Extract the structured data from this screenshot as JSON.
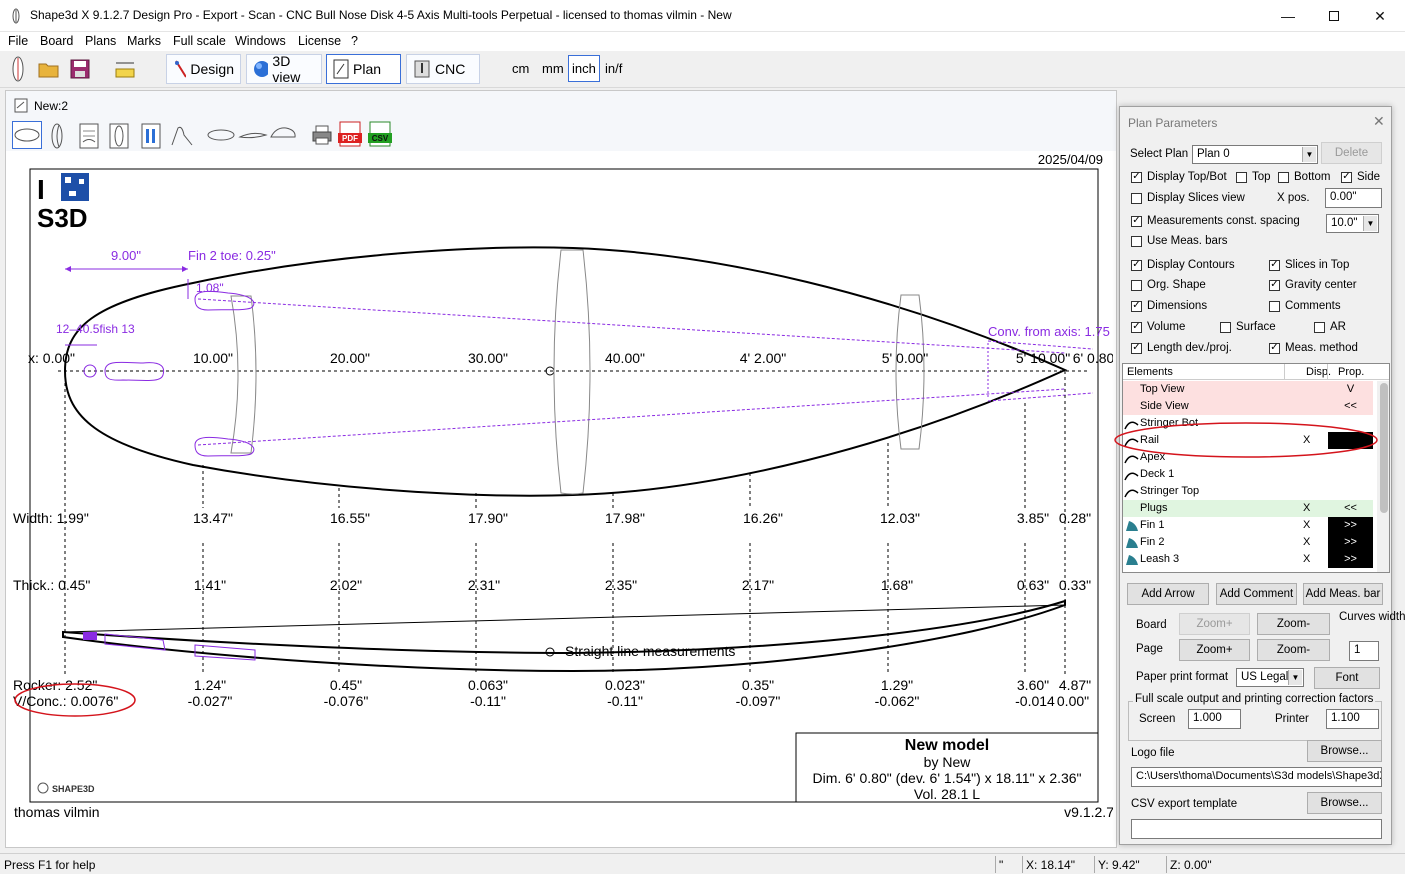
{
  "window": {
    "title": "Shape3d X 9.1.2.7 Design Pro - Export - Scan - CNC Bull Nose Disk 4-5 Axis Multi-tools Perpetual - licensed to thomas vilmin - New"
  },
  "menu": [
    "File",
    "Board",
    "Plans",
    "Marks",
    "Full scale",
    "Windows",
    "License",
    "?"
  ],
  "toolbar": {
    "design": "Design",
    "view3d": "3D view",
    "plan": "Plan",
    "cnc": "CNC",
    "units": [
      "cm",
      "mm",
      "inch",
      "in/f"
    ],
    "active_unit": "inch"
  },
  "doc": {
    "title": "New:2",
    "icons": [
      "outline-icon",
      "profile-icon",
      "slice-icon",
      "stringer-icon",
      "fins-icon",
      "curve-icon",
      "shape-a-icon",
      "shape-b-icon",
      "shape-c-icon",
      "print-icon",
      "pdf-icon",
      "csv-icon"
    ]
  },
  "plan": {
    "date": "2025/04/09",
    "logo_top": "I",
    "logo_bottom": "S3D",
    "dim_length_top": "9.00\"",
    "fin2_toe": "Fin 2 toe: 0.25\"",
    "fin_offset": "1.08\"",
    "fin_overlap": "12–40.5fish 13",
    "conv_axis": "Conv. from axis: 1.75",
    "stations": [
      "x: 0.00\"",
      "10.00\"",
      "20.00\"",
      "30.00\"",
      "40.00\"",
      "4' 2.00\"",
      "5' 0.00\"",
      "5' 10.00\"",
      "6' 0.80\""
    ],
    "width": [
      "Width: 1.99\"",
      "13.47\"",
      "16.55\"",
      "17.90\"",
      "17.98\"",
      "16.26\"",
      "12.03\"",
      "3.85\"",
      "0.28\""
    ],
    "thick": [
      "Thick.: 0.45\"",
      "1.41\"",
      "2.02\"",
      "2.31\"",
      "2.35\"",
      "2.17\"",
      "1.68\"",
      "0.63\"",
      "0.33\""
    ],
    "rocker": [
      "Rocker: 2.52\"",
      "1.24\"",
      "0.45\"",
      "0.063\"",
      "0.023\"",
      "0.35\"",
      "1.29\"",
      "3.60\"",
      "4.87\""
    ],
    "conc": [
      "V/Conc.: 0.0076\"",
      "-0.027\"",
      "-0.076\"",
      "-0.11\"",
      "-0.11\"",
      "-0.097\"",
      "-0.062\"",
      "-0.014",
      "0.00\""
    ],
    "straight_line": "Straight line measurements",
    "model_name": "New model",
    "model_by": "by New",
    "model_dim": "Dim. 6' 0.80\" (dev. 6' 1.54\") x 18.11\" x 2.36\"",
    "model_vol": "Vol. 28.1 L",
    "author": "thomas vilmin",
    "version": "v9.1.2.7",
    "shape3d_mark": "SHAPE3D"
  },
  "panel": {
    "title": "Plan Parameters",
    "select_plan_label": "Select Plan",
    "select_plan_value": "Plan 0",
    "delete": "Delete",
    "display_topbot": "Display Top/Bot",
    "top": "Top",
    "bottom": "Bottom",
    "side": "Side",
    "display_slices": "Display Slices view",
    "xpos_label": "X pos.",
    "xpos_value": "0.00\"",
    "meas_const": "Measurements const. spacing",
    "meas_const_value": "10.0\"",
    "use_meas_bars": "Use Meas. bars",
    "display_contours": "Display Contours",
    "slices_in_top": "Slices in Top",
    "org_shape": "Org. Shape",
    "gravity_center": "Gravity center",
    "dimensions": "Dimensions",
    "comments": "Comments",
    "volume": "Volume",
    "surface": "Surface",
    "ar": "AR",
    "length_dev": "Length dev./proj.",
    "meas_method": "Meas. method",
    "elements_header": [
      "Elements",
      "Disp.",
      "Prop."
    ],
    "elements": [
      {
        "name": "Top View",
        "disp": "",
        "prop": "V",
        "bg": "#fde0e0",
        "propbg": "",
        "icon": ""
      },
      {
        "name": "Side View",
        "disp": "",
        "prop": "<<",
        "bg": "#fde0e0",
        "propbg": "",
        "icon": ""
      },
      {
        "name": "Stringer Bot",
        "disp": "",
        "prop": "",
        "bg": "",
        "propbg": "",
        "icon": "curve"
      },
      {
        "name": "Rail",
        "disp": "X",
        "prop": "",
        "bg": "",
        "propbg": "#000",
        "icon": "curve"
      },
      {
        "name": "Apex",
        "disp": "",
        "prop": "",
        "bg": "",
        "propbg": "",
        "icon": "curve"
      },
      {
        "name": "Deck 1",
        "disp": "",
        "prop": "",
        "bg": "",
        "propbg": "",
        "icon": "curve"
      },
      {
        "name": "Stringer Top",
        "disp": "",
        "prop": "",
        "bg": "",
        "propbg": "",
        "icon": "curve"
      },
      {
        "name": "Plugs",
        "disp": "X",
        "prop": "<<",
        "bg": "#e0f5e0",
        "propbg": "",
        "icon": ""
      },
      {
        "name": "Fin 1",
        "disp": "X",
        "prop": ">>",
        "bg": "",
        "propbg": "#000",
        "icon": "fin"
      },
      {
        "name": "Fin 2",
        "disp": "X",
        "prop": ">>",
        "bg": "",
        "propbg": "#000",
        "icon": "fin"
      },
      {
        "name": "Leash 3",
        "disp": "X",
        "prop": ">>",
        "bg": "",
        "propbg": "#000",
        "icon": "fin"
      }
    ],
    "add_arrow": "Add Arrow",
    "add_comment": "Add Comment",
    "add_meas_bar": "Add Meas. bar",
    "board_label": "Board",
    "page_label": "Page",
    "zoom_plus": "Zoom+",
    "zoom_minus": "Zoom-",
    "curves_width_label": "Curves width",
    "curves_width_value": "1",
    "paper_format_label": "Paper print format",
    "paper_format_value": "US Legal",
    "font": "Font",
    "fullscale_label": "Full scale output and printing correction factors",
    "screen_label": "Screen",
    "screen_value": "1.000",
    "printer_label": "Printer",
    "printer_value": "1.100",
    "logo_file_label": "Logo file",
    "browse": "Browse...",
    "logo_path": "C:\\Users\\thoma\\Documents\\S3d models\\Shape3dX",
    "csv_label": "CSV export template",
    "csv_value": ""
  },
  "status": {
    "help": "Press F1 for help",
    "unit": "\"",
    "x": "X: 18.14\"",
    "y": "Y: 9.42\"",
    "z": "Z: 0.00\""
  },
  "colors": {
    "accent_purple": "#9b30d9",
    "annotation_red": "#d4141c",
    "selected_border": "#3a6fd8"
  }
}
